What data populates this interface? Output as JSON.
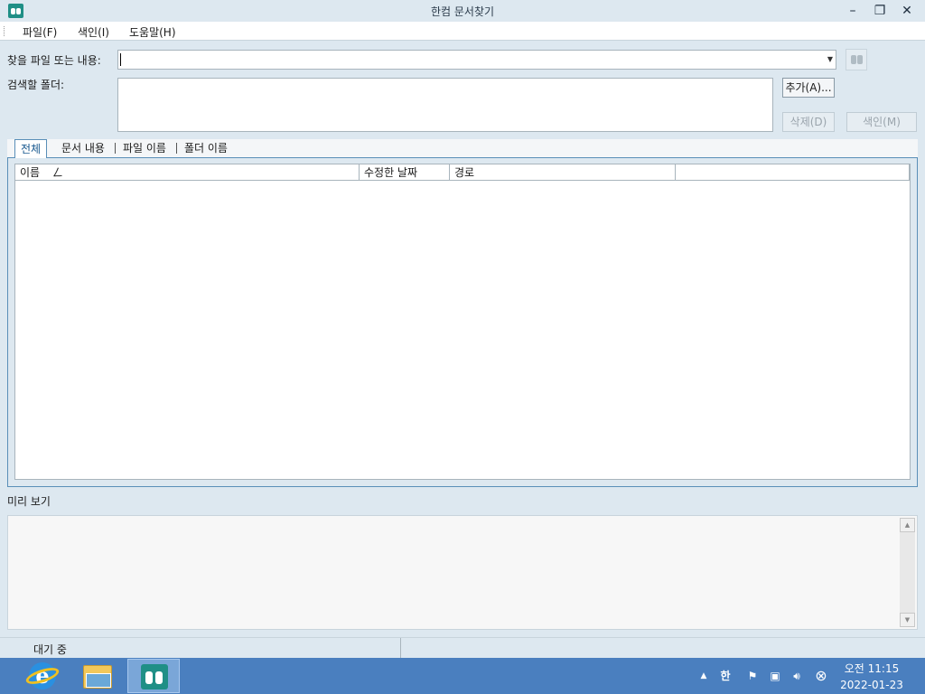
{
  "window": {
    "title": "한컴 문서찾기"
  },
  "menu": [
    {
      "label": "파일(F)"
    },
    {
      "label": "색인(I)"
    },
    {
      "label": "도움말(H)"
    }
  ],
  "search": {
    "label": "찾을 파일 또는 내용:",
    "value": ""
  },
  "folders": {
    "label": "검색할 폴더:",
    "add_button": "추가(A)...",
    "delete_button": "삭제(D)",
    "index_button": "색인(M)"
  },
  "tabs": [
    {
      "label": "전체",
      "active": true
    },
    {
      "label": "문서 내용"
    },
    {
      "label": "파일 이름"
    },
    {
      "label": "폴더 이름"
    }
  ],
  "columns": [
    {
      "label": "이름",
      "sort": "ㄥ"
    },
    {
      "label": "수정한 날짜"
    },
    {
      "label": "경로"
    },
    {
      "label": ""
    }
  ],
  "preview": {
    "label": "미리 보기"
  },
  "status": {
    "text": "대기 중"
  },
  "taskbar": {
    "ime": "한",
    "clock_time": "오전 11:15",
    "clock_date": "2022-01-23"
  }
}
